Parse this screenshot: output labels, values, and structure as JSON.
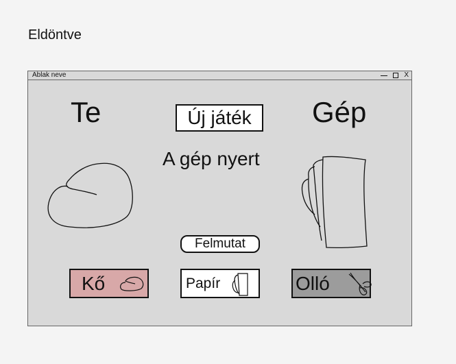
{
  "page": {
    "heading": "Eldöntve"
  },
  "window": {
    "title": "Ablak neve",
    "controls": {
      "minimize": "—",
      "maximize": "□",
      "close": "X"
    }
  },
  "game": {
    "player_label": "Te",
    "computer_label": "Gép",
    "new_game_label": "Új játék",
    "result_text": "A gép nyert",
    "player_choice_icon": "rock-hand-icon",
    "computer_choice_icon": "paper-hand-icon",
    "show_button_label": "Felmutat",
    "choices": [
      {
        "label": "Kő",
        "icon": "rock-icon",
        "color": "#d8a8a8"
      },
      {
        "label": "Papír",
        "icon": "paper-icon",
        "color": "#ffffff"
      },
      {
        "label": "Olló",
        "icon": "scissors-icon",
        "color": "#9c9c9c"
      }
    ]
  }
}
